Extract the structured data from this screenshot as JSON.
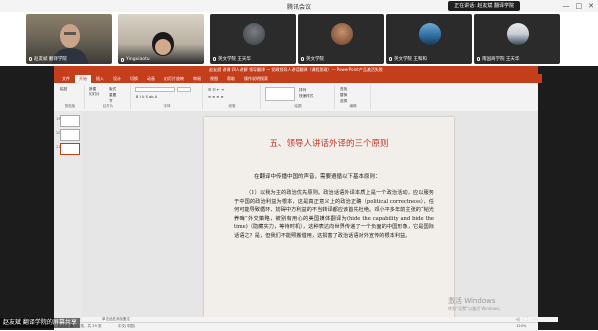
{
  "meeting": {
    "title": "腾讯会议",
    "speaking_label": "正在讲话: 赵友斌 翻译学院",
    "window_controls": [
      "—",
      "□",
      "✕"
    ]
  },
  "participants": [
    {
      "name": "赵友斌 翻译学院",
      "mic": "mic-icon"
    },
    {
      "name": "Yingxiaotu",
      "mic": "mic-icon"
    },
    {
      "name": "英文学院 王天华",
      "mic": "mic-icon"
    },
    {
      "name": "英文学院",
      "mic": "mic-icon"
    },
    {
      "name": "英文学院 王和和",
      "mic": "mic-icon"
    },
    {
      "name": "南国商学院 王天华",
      "mic": "mic-icon"
    }
  ],
  "ppt": {
    "title": "赵友斌 讲课 四人讲解  领导翻译 — 党政领导人讲话翻译（课程思政）— PowerPoint产品激活失败",
    "menu": [
      "文件",
      "开始",
      "插入",
      "设计",
      "切换",
      "动画",
      "幻灯片放映",
      "审阅",
      "视图",
      "帮助",
      "操作说明搜索"
    ],
    "active_menu_index": 1,
    "ribbon": {
      "groups": [
        "剪贴板",
        "幻灯片",
        "字体",
        "段落",
        "绘图",
        "编辑"
      ],
      "buttons": {
        "paste": "粘贴",
        "new_slide": "新建\n幻灯片",
        "reuse": "重用\n幻灯片",
        "layout": "版式",
        "reset": "重置",
        "section": "节",
        "arrange": "排列",
        "quick_styles": "快速样式",
        "find": "查找",
        "replace": "替换",
        "select": "选择"
      }
    },
    "slide": {
      "title": "五、领导人讲话外译的三个原则",
      "intro": "在翻译中传播中国的声音，需要遵循以下基本原则：",
      "body": "（1）以我为主的政治优先原则。政治话语外译本质上是一个政治活动，应以服务于中国的政治利益为根本，这是真正意义上的政治正确（political correctness），任何可能导致循环、妨碍中方利益的不当转译都应该首先杜绝。邓小平多年前主张的“韬光养晦”外交策略，被别有用心的美国媒体翻译为(hide the capability and bide the time)（隐藏实力，等待时机），这种表达向世界传递了一个负面的中国形象，它是国际话语之？是，但我们不能照搬借用，这损害了政治话语对外宣传的根本利益。"
    },
    "notes_placeholder": "单击此处添加备注",
    "status": {
      "slide_info": "幻灯片 第 21 张，共 29 张",
      "language": "中文(中国)",
      "zoom": "120%"
    }
  },
  "overlay": {
    "speaker_caption": "赵友斌 翻译学院的屏幕共享",
    "activate_title": "激活 Windows",
    "activate_sub": "转到“设置”以激活 Windows。"
  }
}
